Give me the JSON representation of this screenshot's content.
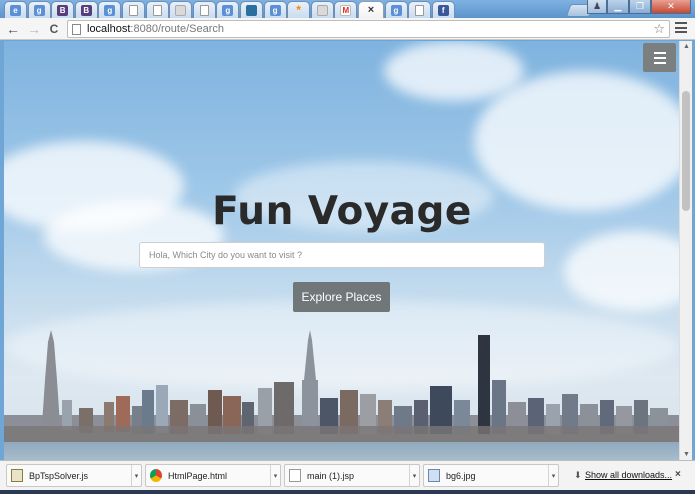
{
  "tabs": [
    {
      "icon": "internet-explorer-icon",
      "glyph": "e",
      "kind": "g"
    },
    {
      "icon": "google-icon",
      "glyph": "g",
      "kind": "g"
    },
    {
      "icon": "bootstrap-icon",
      "glyph": "B",
      "kind": "bs"
    },
    {
      "icon": "bootstrap-icon",
      "glyph": "B",
      "kind": "bs"
    },
    {
      "icon": "google-icon",
      "glyph": "g",
      "kind": "g"
    },
    {
      "icon": "document-icon",
      "glyph": "",
      "kind": "doc"
    },
    {
      "icon": "document-icon",
      "glyph": "",
      "kind": "doc"
    },
    {
      "icon": "chart-icon",
      "glyph": "",
      "kind": "chart"
    },
    {
      "icon": "document-icon",
      "glyph": "",
      "kind": "doc"
    },
    {
      "icon": "google-icon",
      "glyph": "g",
      "kind": "g"
    },
    {
      "icon": "photo-icon",
      "glyph": "",
      "kind": "pn"
    },
    {
      "icon": "google-icon",
      "glyph": "g",
      "kind": "g"
    },
    {
      "icon": "asterisk-icon",
      "glyph": "*",
      "kind": "star"
    },
    {
      "icon": "chart-icon",
      "glyph": "",
      "kind": "chart"
    },
    {
      "icon": "gmail-icon",
      "glyph": "M",
      "kind": "gm"
    },
    {
      "icon": "close-icon",
      "glyph": "×",
      "kind": "active"
    },
    {
      "icon": "google-icon",
      "glyph": "g",
      "kind": "g"
    },
    {
      "icon": "document-icon",
      "glyph": "",
      "kind": "doc"
    },
    {
      "icon": "facebook-icon",
      "glyph": "f",
      "kind": "fb"
    }
  ],
  "window": {
    "user_glyph": "♟",
    "min_glyph": "▁",
    "max_glyph": "❐",
    "close_glyph": "✕"
  },
  "toolbar": {
    "back_glyph": "←",
    "forward_glyph": "→",
    "reload_glyph": "C",
    "url_host": "localhost",
    "url_path": ":8080/route/Search",
    "star_glyph": "☆"
  },
  "page": {
    "title": "Fun Voyage",
    "search_placeholder": "Hola, Which City do you want to visit ?",
    "explore_label": "Explore Places"
  },
  "downloads": [
    {
      "name": "BpTspSolver.js",
      "icon": "exe"
    },
    {
      "name": "HtmlPage.html",
      "icon": "chrome"
    },
    {
      "name": "main (1).jsp",
      "icon": "doc"
    },
    {
      "name": "bg6.jpg",
      "icon": "jpg"
    }
  ],
  "shelf": {
    "show_all": "Show all downloads...",
    "close_glyph": "×",
    "download_glyph": "⬇"
  }
}
